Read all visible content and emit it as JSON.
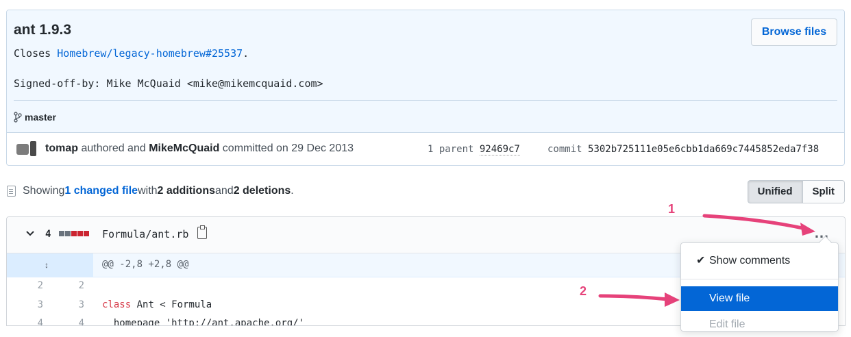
{
  "commit": {
    "title": "ant 1.9.3",
    "msg_prefix": "Closes ",
    "msg_link": "Homebrew/legacy-homebrew#25537",
    "msg_suffix": ".",
    "signoff": "Signed-off-by: Mike McQuaid <mike@mikemcquaid.com>",
    "branch": "master",
    "browse_label": "Browse files",
    "author": "tomap",
    "authored_text": " authored and ",
    "committer": "MikeMcQuaid",
    "committed_text": " committed on 29 Dec 2013",
    "parent_label": "1 parent ",
    "parent_sha": "92469c7",
    "commit_label": "commit ",
    "commit_sha": "5302b725111e05e6cbb1da669c7445852eda7f38"
  },
  "summary": {
    "prefix": "Showing ",
    "changed": "1 changed file",
    "mid1": " with ",
    "additions": "2 additions",
    "mid2": " and ",
    "deletions": "2 deletions",
    "end": "."
  },
  "view_toggle": {
    "unified": "Unified",
    "split": "Split",
    "selected": "Unified"
  },
  "file": {
    "change_count": "4",
    "diffstat": [
      "neutral",
      "neutral",
      "deleted",
      "deleted",
      "deleted"
    ],
    "name": "Formula/ant.rb",
    "more": "…",
    "hunk": "@@ -2,8 +2,8 @@",
    "lines": [
      {
        "old": "2",
        "new": "2",
        "code": ""
      },
      {
        "old": "3",
        "new": "3",
        "kw": "class",
        "code": " Ant < Formula"
      },
      {
        "old": "4",
        "new": "4",
        "code": "  homepage 'http://ant.apache.org/'"
      }
    ]
  },
  "annotations": {
    "step1": "1",
    "step2": "2"
  },
  "menu": {
    "show_comments": "Show comments",
    "view_file": "View file",
    "edit_file": "Edit file"
  },
  "colors": {
    "link": "#0366d6",
    "annotation": "#e6427a",
    "selected": "#0366d6"
  }
}
